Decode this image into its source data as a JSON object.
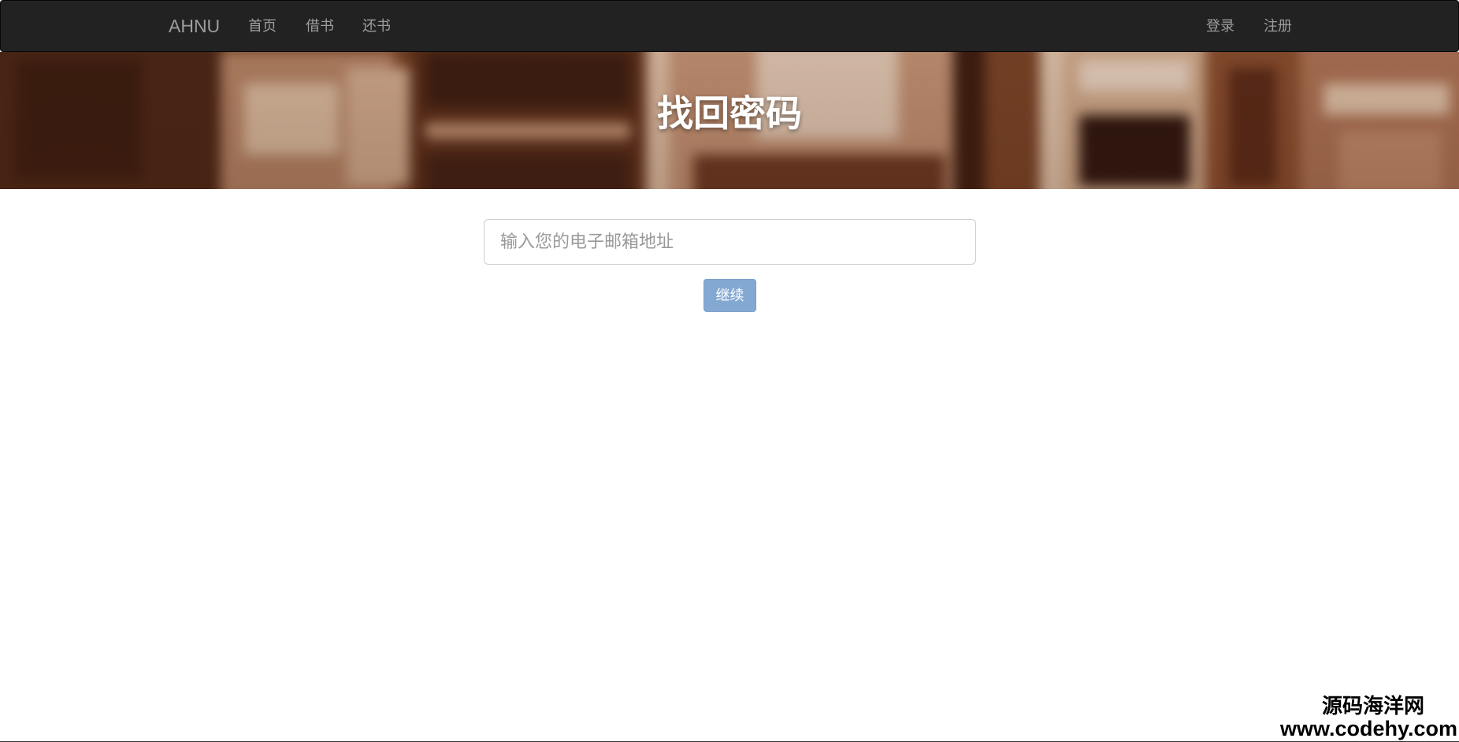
{
  "navbar": {
    "brand": "AHNU",
    "left_links": [
      "首页",
      "借书",
      "还书"
    ],
    "right_links": [
      "登录",
      "注册"
    ]
  },
  "hero": {
    "title": "找回密码"
  },
  "form": {
    "email_placeholder": "输入您的电子邮箱地址",
    "email_value": "",
    "continue_label": "继续"
  },
  "watermark": {
    "name": "源码海洋网",
    "url": "www.codehy.com"
  },
  "colors": {
    "navbar_bg": "#222222",
    "nav_text": "#9d9d9d",
    "button_bg": "#83a9d3",
    "hero_tone": "#6b3a22"
  }
}
